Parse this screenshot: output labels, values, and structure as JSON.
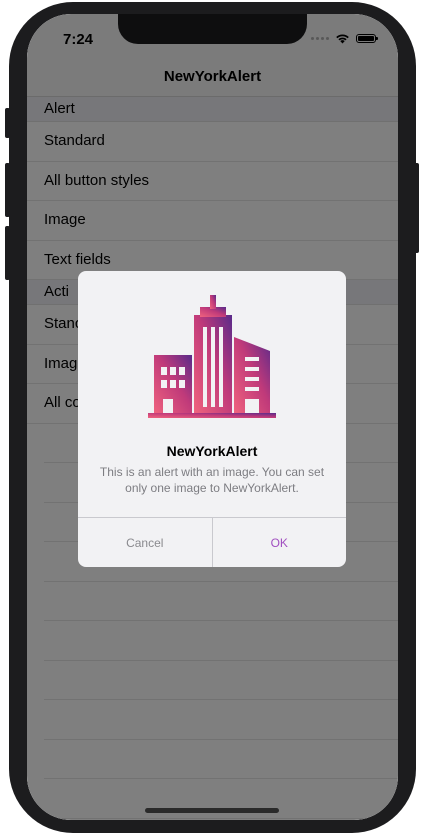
{
  "status_bar": {
    "time": "7:24",
    "icons": [
      "signal-dots-icon",
      "wifi-icon",
      "battery-icon"
    ]
  },
  "navbar": {
    "title": "NewYorkAlert"
  },
  "sections": [
    {
      "header": "Alert",
      "rows": [
        "Standard",
        "All button styles",
        "Image",
        "Text fields"
      ]
    },
    {
      "header": "Acti",
      "rows": [
        "Stanc",
        "Imag",
        "All co"
      ]
    }
  ],
  "alert": {
    "image": "city-buildings-icon",
    "title": "NewYorkAlert",
    "message": "This is an alert with an image. You can set only one image to NewYorkAlert.",
    "buttons": {
      "cancel": "Cancel",
      "ok": "OK"
    }
  },
  "colors": {
    "accent": "#a14fc0",
    "gradient_start": "#f0637e",
    "gradient_end": "#5a2a8a",
    "dim_overlay": "rgba(0,0,0,0.5)",
    "phone_frame": "#1c1c1e"
  }
}
